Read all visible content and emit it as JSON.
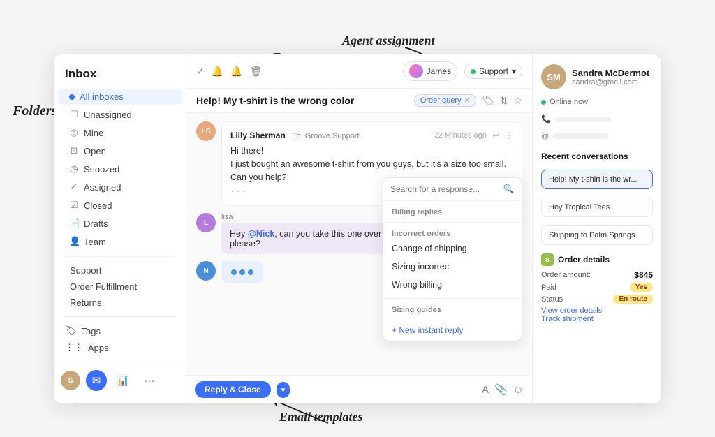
{
  "annotations": {
    "folders": "Folders",
    "tags": "Tags",
    "agent_assignment": "Agent assignment",
    "email_templates": "Email templates"
  },
  "sidebar": {
    "title": "Inbox",
    "items": [
      {
        "label": "All inboxes",
        "icon": "dot",
        "dotColor": "#3b6ef6",
        "active": true
      },
      {
        "label": "Unassigned",
        "icon": "square"
      },
      {
        "label": "Mine",
        "icon": "circle-check"
      },
      {
        "label": "Open",
        "icon": "inbox"
      },
      {
        "label": "Snoozed",
        "icon": "clock"
      },
      {
        "label": "Assigned",
        "icon": "check"
      },
      {
        "label": "Closed",
        "icon": "check-square"
      },
      {
        "label": "Drafts",
        "icon": "file"
      },
      {
        "label": "Team",
        "icon": "person"
      }
    ],
    "labels": [
      {
        "label": "Support",
        "dotColor": "#22c55e"
      },
      {
        "label": "Order Fulfillment",
        "dotColor": "#f59e0b"
      },
      {
        "label": "Returns",
        "dotColor": "#ef4444"
      }
    ],
    "tags_label": "Tags",
    "apps_label": "Apps",
    "bottom": {
      "mail_icon": "✉",
      "chart_icon": "📊",
      "more_icon": "···"
    }
  },
  "conversation": {
    "toolbar_icons": [
      "✓",
      "🔔",
      "🔔",
      "🗑"
    ],
    "title": "Help! My t-shirt is the wrong color",
    "tag": "Order query",
    "agent": "James",
    "mailbox": "Support",
    "messages": [
      {
        "id": "msg1",
        "sender": "Lilly Sherman",
        "to": "To: Groove Support",
        "time": "22 Minutes ago",
        "body_line1": "Hi there!",
        "body_line2": "I just bought an awesome t-shirt from you guys, but it's a size too small.",
        "body_line3": "Can you help?",
        "avatar_initials": "LS",
        "avatar_color": "#e8a87c"
      },
      {
        "id": "msg2",
        "sender": "lisa",
        "body": "Hey @Nick, can you take this one over please?",
        "mention": "@Nick",
        "avatar_initials": "L",
        "avatar_color": "#b57adb"
      },
      {
        "id": "msg3",
        "sender": "typing",
        "avatar_initials": "N",
        "avatar_color": "#4a90d9"
      }
    ]
  },
  "dropdown": {
    "search_placeholder": "Search for a response...",
    "sections": [
      {
        "label": "Billing replies",
        "items": []
      },
      {
        "label": "Incorrect orders",
        "items": [
          {
            "label": "Change of shipping"
          },
          {
            "label": "Sizing incorrect"
          },
          {
            "label": "Wrong billing"
          }
        ]
      },
      {
        "label": "Sizing guides",
        "items": []
      }
    ],
    "new_instant_reply": "+ New instant reply"
  },
  "reply_bar": {
    "button_label": "Reply & Close",
    "chevron": "▾",
    "format_icon": "A",
    "attach_icon": "📎",
    "emoji_icon": "☺"
  },
  "right_panel": {
    "contact": {
      "name": "Sandra McDermot",
      "email": "sandra@gmail.com",
      "status": "Online now",
      "avatar_initials": "SM"
    },
    "recent_conversations_title": "Recent conversations",
    "conversations": [
      {
        "label": "Help! My t-shirt is the wr...",
        "active": true
      },
      {
        "label": "Hey Tropical Tees"
      },
      {
        "label": "Shipping to Palm Springs"
      }
    ],
    "order_details_title": "Order details",
    "order": {
      "amount_label": "Order amount:",
      "amount": "$845",
      "paid_label": "Paid",
      "paid_badge": "Yes",
      "status_label": "Status",
      "status_badge": "En route",
      "view_link": "View order details",
      "track_link": "Track shipment"
    }
  }
}
